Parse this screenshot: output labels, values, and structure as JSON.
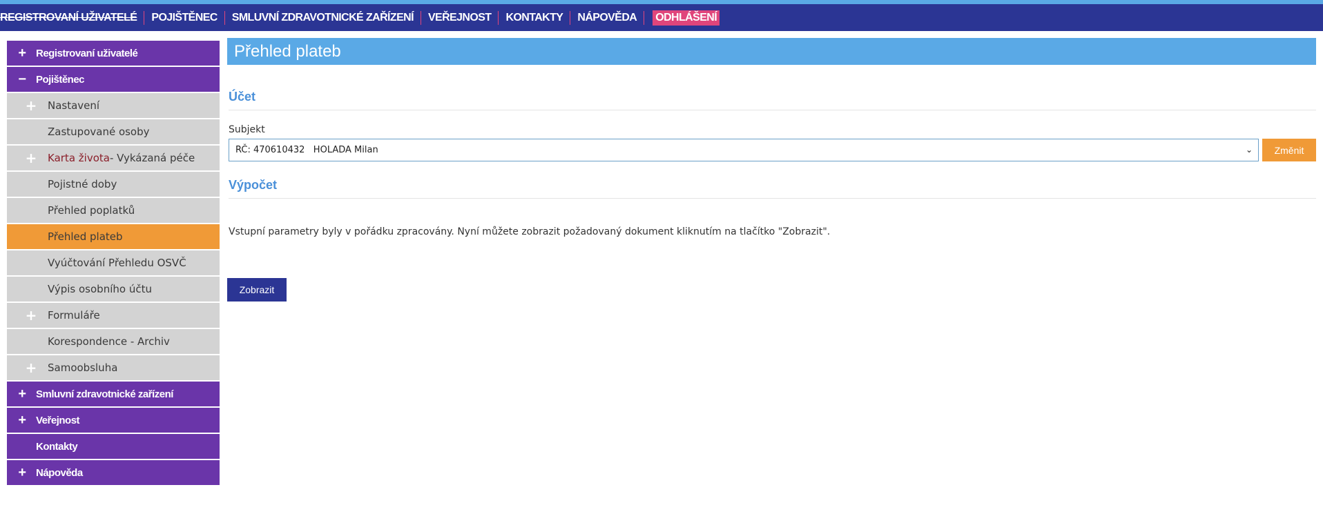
{
  "topnav": {
    "items": [
      "REGISTROVANÍ UŽIVATELÉ",
      "POJIŠTĚNEC",
      "SMLUVNÍ ZDRAVOTNICKÉ ZAŘÍZENÍ",
      "VEŘEJNOST",
      "KONTAKTY",
      "NÁPOVĚDA"
    ],
    "logout": "ODHLÁŠENÍ"
  },
  "sidebar": {
    "plus": "+",
    "minus": "−",
    "items": [
      "Registrovaní uživatelé",
      "Pojištěnec",
      "Nastavení",
      "Zastupované osoby",
      "Karta života",
      " - Vykázaná péče",
      "Pojistné doby",
      "Přehled poplatků",
      "Přehled plateb",
      "Vyúčtování Přehledu OSVČ",
      "Výpis osobního účtu",
      "Formuláře",
      "Korespondence - Archiv",
      "Samoobsluha",
      "Smluvní zdravotnické zařízení",
      "Veřejnost",
      "Kontakty",
      "Nápověda"
    ]
  },
  "main": {
    "title": "Přehled plateb",
    "section_account": "Účet",
    "subject_label": "Subjekt",
    "subject_value": "RČ: 470610432   HOLADA Milan",
    "change_button": "Změnit",
    "section_calc": "Výpočet",
    "info": "Vstupní parametry byly v pořádku zpracovány. Nyní můžete zobrazit požadovaný dokument kliknutím na tlačítko \"Zobrazit\".",
    "show_button": "Zobrazit"
  },
  "colors": {
    "nav_bg": "#2b3594",
    "accent_blue": "#5aa9e6",
    "purple": "#6a35a9",
    "active_orange": "#f09a37",
    "logout_pink": "#e0457b"
  }
}
